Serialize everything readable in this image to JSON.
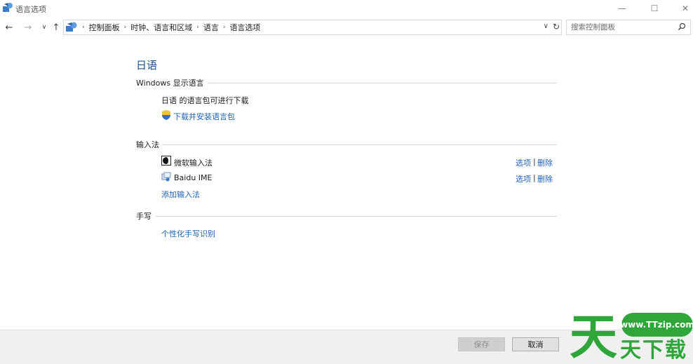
{
  "window": {
    "title": "语言选项",
    "minimize": "—",
    "maximize": "☐",
    "close": "✕"
  },
  "nav": {
    "back": "←",
    "forward": "→",
    "recent": "∨",
    "up": "↑",
    "breadcrumbs": [
      "控制面板",
      "时钟、语言和区域",
      "语言",
      "语言选项"
    ],
    "breadcrumb_separator": "›",
    "dropdown": "∨",
    "refresh": "↻",
    "search_placeholder": "搜索控制面板"
  },
  "page": {
    "title": "日语",
    "display_language": {
      "header": "Windows 显示语言",
      "status": "日语 的语言包可进行下载",
      "download_link": "下载并安装语言包"
    },
    "input_methods": {
      "header": "输入法",
      "items": [
        {
          "name": "微软输入法",
          "options": "选项",
          "separator": "|",
          "remove": "删除"
        },
        {
          "name": "Baidu IME",
          "options": "选项",
          "separator": "|",
          "remove": "删除"
        }
      ],
      "add_link": "添加输入法"
    },
    "handwriting": {
      "header": "手写",
      "personalize_link": "个性化手写识别"
    }
  },
  "footer": {
    "save_label": "保存",
    "cancel_label": "取消"
  },
  "watermark": {
    "url": "www.TTzip.com",
    "big_char": "天",
    "text": "天下载"
  },
  "colors": {
    "link": "#1e63b8",
    "title": "#1e4f8c",
    "watermark": "#2ea63a"
  }
}
